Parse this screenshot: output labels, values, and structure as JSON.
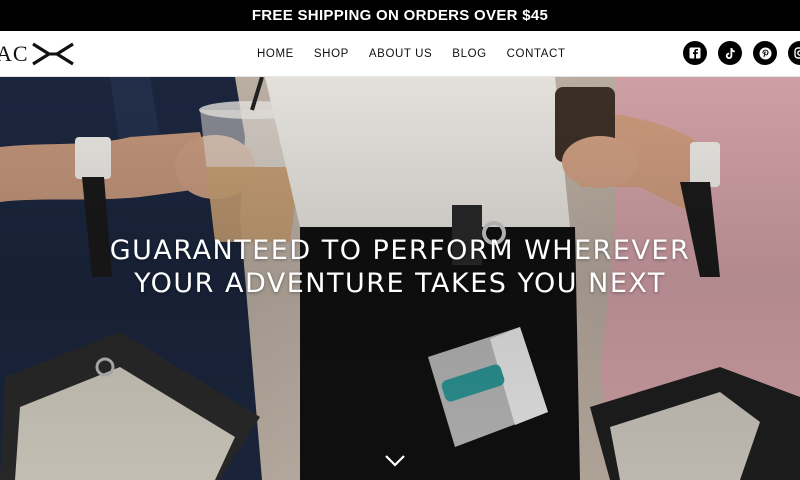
{
  "announcement": {
    "text": "FREE SHIPPING ON ORDERS OVER $45"
  },
  "logo": {
    "text": "AC",
    "icon": "brand-chevrons-icon"
  },
  "nav": {
    "items": [
      {
        "label": "HOME"
      },
      {
        "label": "SHOP"
      },
      {
        "label": "ABOUT US"
      },
      {
        "label": "BLOG"
      },
      {
        "label": "CONTACT"
      }
    ]
  },
  "social": {
    "icons": [
      "facebook-icon",
      "tiktok-icon",
      "pinterest-icon",
      "instagram-icon"
    ]
  },
  "hero": {
    "title_line1": "GUARANTEED TO PERFORM WHEREVER",
    "title_line2": "YOUR ADVENTURE TAKES YOU NEXT",
    "scroll_icon": "chevron-down-icon"
  },
  "colors": {
    "announcement_bg": "#000000",
    "header_bg": "#ffffff",
    "text_dark": "#111111",
    "hero_text": "#ffffff"
  }
}
